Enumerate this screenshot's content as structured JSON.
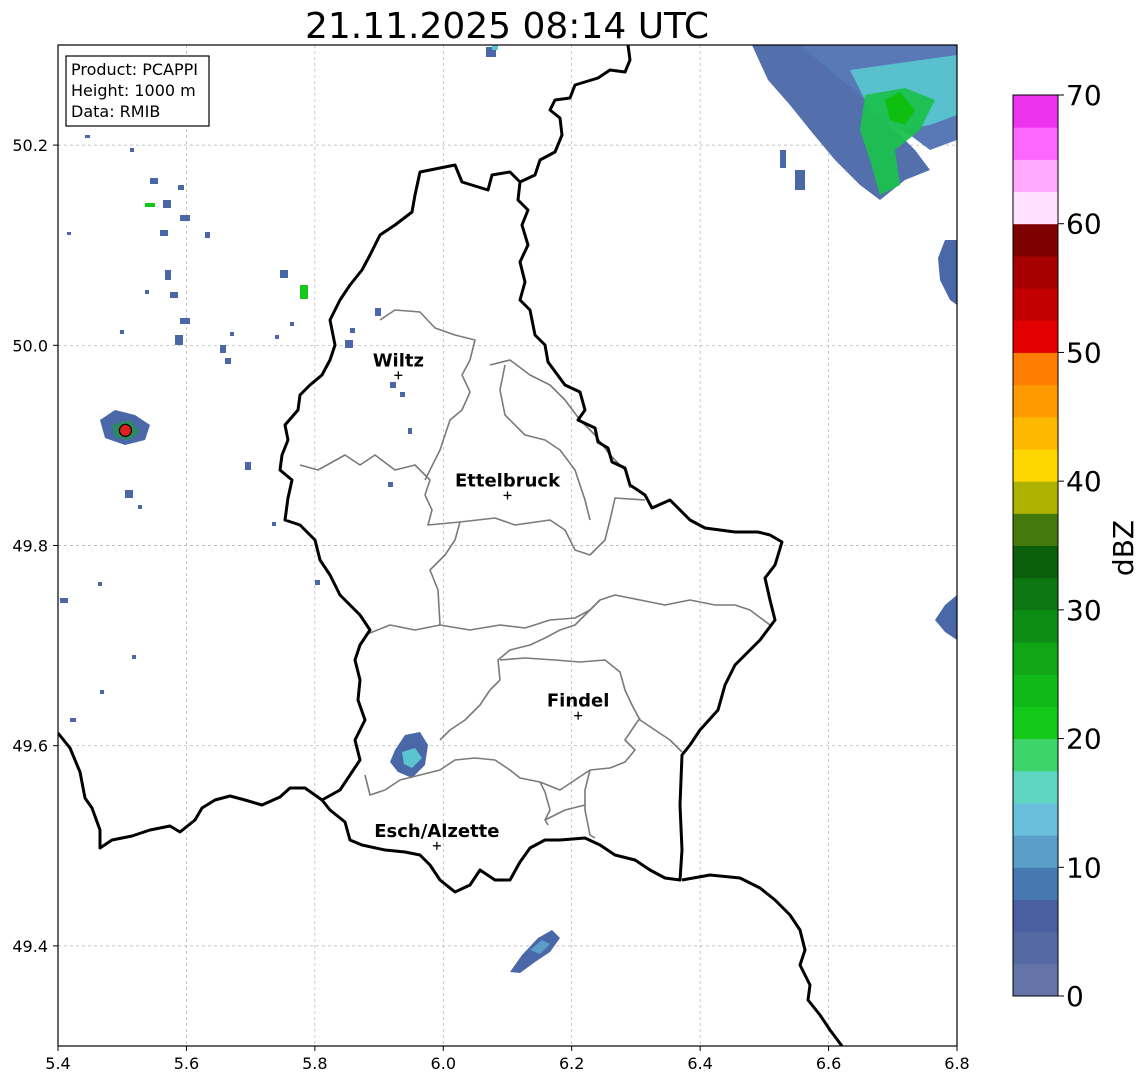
{
  "map": {
    "title": "21.11.2025 08:14 UTC",
    "info_box": {
      "product": "Product: PCAPPI",
      "height": "Height: 1000 m",
      "data": "Data: RMIB"
    },
    "x_ticks": [
      "5.4",
      "5.6",
      "5.8",
      "6.0",
      "6.2",
      "6.4",
      "6.6",
      "6.8"
    ],
    "y_ticks": [
      "50.2",
      "50.0",
      "49.8",
      "49.6",
      "49.4"
    ],
    "x_range": [
      5.4,
      6.8
    ],
    "y_range": [
      49.3,
      50.3
    ],
    "cities": [
      {
        "name": "Wiltz",
        "lon": 5.93,
        "lat": 49.97
      },
      {
        "name": "Ettelbruck",
        "lon": 6.1,
        "lat": 49.85
      },
      {
        "name": "Findel",
        "lon": 6.21,
        "lat": 49.63
      },
      {
        "name": "Esch/Alzette",
        "lon": 5.99,
        "lat": 49.5
      }
    ],
    "radar_site": {
      "lon": 5.505,
      "lat": 49.915,
      "color": "#e0201e"
    }
  },
  "colorbar": {
    "unit": "dBZ",
    "tick_labels": [
      "0",
      "10",
      "20",
      "30",
      "40",
      "50",
      "60",
      "70"
    ],
    "min": 0,
    "max": 70,
    "colors": [
      "#6474a9",
      "#556aa2",
      "#4a5fa0",
      "#4779b1",
      "#5a9ec9",
      "#68c0dc",
      "#5fd6c2",
      "#3dd46c",
      "#14c81a",
      "#10b918",
      "#0fa716",
      "#0d8d13",
      "#0c7711",
      "#0a5e0c",
      "#447a0b",
      "#afb100",
      "#ffd600",
      "#ffb800",
      "#ff9a00",
      "#ff7d00",
      "#e40000",
      "#c30000",
      "#a70000",
      "#7e0000",
      "#ffe1ff",
      "#ffaaff",
      "#ff66ff",
      "#ee33ee"
    ]
  }
}
